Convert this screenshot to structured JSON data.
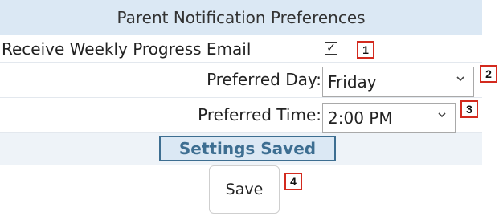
{
  "header": {
    "title": "Parent Notification Preferences"
  },
  "weekly_email": {
    "label": "Receive Weekly Progress Email",
    "checked": true,
    "check_glyph": "✓"
  },
  "preferred_day": {
    "label": "Preferred Day:",
    "value": "Friday"
  },
  "preferred_time": {
    "label": "Preferred Time:",
    "value": "2:00 PM"
  },
  "status": {
    "text": "Settings Saved"
  },
  "save": {
    "label": "Save"
  },
  "annotations": {
    "badge_1": "1",
    "badge_2": "2",
    "badge_3": "3",
    "badge_4": "4"
  },
  "colors": {
    "header_bg": "#dbe8f4",
    "status_border": "#3d6e91",
    "status_text": "#3d6e91",
    "badge_border": "#d32a1e"
  }
}
